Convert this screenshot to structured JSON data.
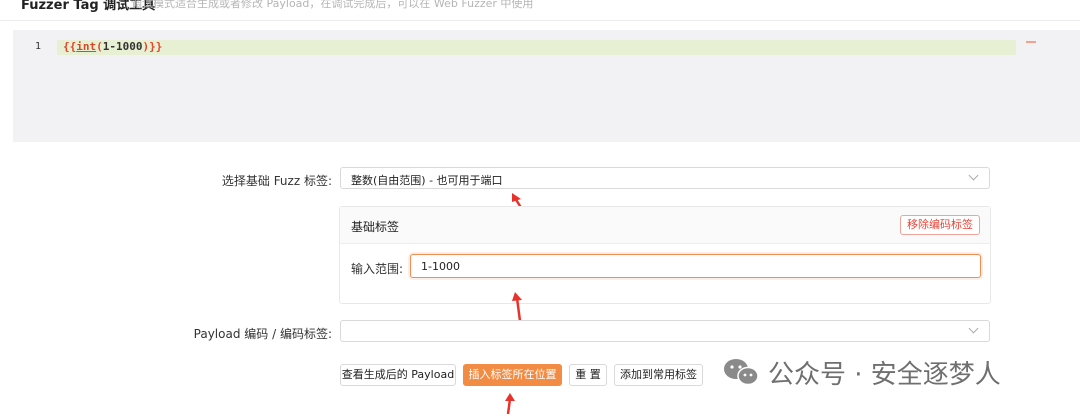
{
  "header": {
    "title": "Fuzzer Tag 调试工具",
    "description": "调试模式适合生成或者修改 Payload，在调试完成后，可以在 Web Fuzzer 中使用"
  },
  "editor": {
    "line_number": "1",
    "code": {
      "open": "{{",
      "func": "int",
      "paren_open": "(",
      "args": "1-1000",
      "paren_close": ")",
      "close": "}}"
    }
  },
  "form": {
    "fuzz_tag_label": "选择基础 Fuzz 标签:",
    "fuzz_tag_value": "整数(自由范围) - 也可用于端口",
    "card_title": "基础标签",
    "remove_encode_label": "移除编码标签",
    "range_label": "输入范围:",
    "range_value": "1-1000",
    "payload_encode_label": "Payload 编码 / 编码标签:",
    "payload_encode_value": ""
  },
  "buttons": {
    "view_payload": "查看生成后的 Payload",
    "insert_tag": "插入标签所在位置",
    "reset": "重 置",
    "add_common": "添加到常用标签"
  },
  "watermark": {
    "text": "公众号 · 安全逐梦人"
  },
  "colors": {
    "accent": "#f28c44",
    "danger": "#e9473a",
    "annotation_arrow": "#e8322b"
  }
}
